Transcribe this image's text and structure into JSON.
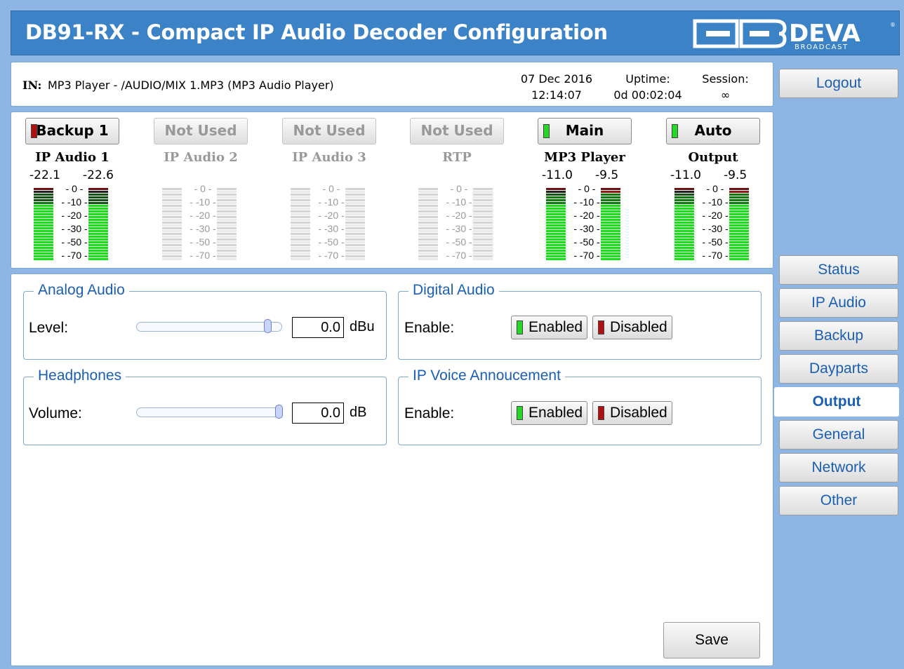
{
  "header": {
    "title": "DB91-RX - Compact IP Audio Decoder Configuration",
    "logo_text": "DEVA",
    "logo_subtext": "BROADCAST",
    "logo_mark": "DB"
  },
  "info": {
    "in_label": "IN:",
    "in_value": "MP3 Player - /AUDIO/MIX 1.MP3 (MP3 Audio Player)",
    "date": "07 Dec 2016",
    "time": "12:14:07",
    "uptime_label": "Uptime:",
    "uptime_value": "0d 00:02:04",
    "session_label": "Session:",
    "session_value": "∞"
  },
  "sources": [
    {
      "button": "Backup 1",
      "label": "IP Audio 1",
      "led": "red",
      "active": true,
      "level_l": "-22.1",
      "level_r": "-22.6",
      "fill_l": 0.8,
      "fill_r": 0.78
    },
    {
      "button": "Not Used",
      "label": "IP Audio 2",
      "led": "none",
      "active": false,
      "level_l": "",
      "level_r": "",
      "fill_l": 0,
      "fill_r": 0
    },
    {
      "button": "Not Used",
      "label": "IP Audio 3",
      "led": "none",
      "active": false,
      "level_l": "",
      "level_r": "",
      "fill_l": 0,
      "fill_r": 0
    },
    {
      "button": "Not Used",
      "label": "RTP",
      "led": "none",
      "active": false,
      "level_l": "",
      "level_r": "",
      "fill_l": 0,
      "fill_r": 0
    },
    {
      "button": "Main",
      "label": "MP3 Player",
      "led": "green",
      "active": true,
      "level_l": "-11.0",
      "level_r": "-9.5",
      "fill_l": 0.88,
      "fill_r": 0.95
    },
    {
      "button": "Auto",
      "label": "Output",
      "led": "green",
      "active": true,
      "level_l": "-11.0",
      "level_r": "-9.5",
      "fill_l": 0.88,
      "fill_r": 0.95
    }
  ],
  "meter_scale": [
    "0",
    "-10",
    "-20",
    "-30",
    "-50",
    "-70"
  ],
  "analog_audio": {
    "legend": "Analog Audio",
    "field_label": "Level:",
    "value": "0.0",
    "unit": "dBu",
    "slider_fraction": 0.92
  },
  "headphones": {
    "legend": "Headphones",
    "field_label": "Volume:",
    "value": "0.0",
    "unit": "dB",
    "slider_fraction": 1.0
  },
  "digital_audio": {
    "legend": "Digital Audio",
    "field_label": "Enable:",
    "enabled_label": "Enabled",
    "disabled_label": "Disabled"
  },
  "ip_voice": {
    "legend": "IP Voice Annoucement",
    "field_label": "Enable:",
    "enabled_label": "Enabled",
    "disabled_label": "Disabled"
  },
  "save_label": "Save",
  "logout_label": "Logout",
  "nav": [
    {
      "label": "Status",
      "active": false
    },
    {
      "label": "IP Audio",
      "active": false
    },
    {
      "label": "Backup",
      "active": false
    },
    {
      "label": "Dayparts",
      "active": false
    },
    {
      "label": "Output",
      "active": true
    },
    {
      "label": "General",
      "active": false
    },
    {
      "label": "Network",
      "active": false
    },
    {
      "label": "Other",
      "active": false
    }
  ],
  "colors": {
    "background": "#8db6e4",
    "header": "#3c82c6",
    "accent": "#1a5fb4",
    "led_green": "#25d825",
    "led_red": "#b01010"
  }
}
